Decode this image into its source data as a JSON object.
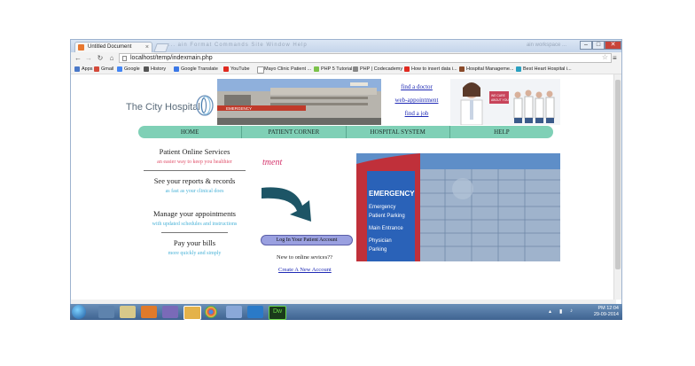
{
  "browser": {
    "tab_title": "Untitled Document",
    "tab_close": "×",
    "menu_words": "...  ain   Format   Commands   Site   Window   Help",
    "right_words": "ain  workspace ...",
    "url": "localhost/temp/indexmain.php",
    "window_controls": {
      "minimize": "–",
      "maximize": "□",
      "close": "✕"
    }
  },
  "bookmarks": [
    {
      "label": "Apps",
      "color": "#4a78c8"
    },
    {
      "label": "Gmail",
      "color": "#d44a3a"
    },
    {
      "label": "Google",
      "color": "#4285f4"
    },
    {
      "label": "History",
      "color": "#555555"
    },
    {
      "label": "Google Translate",
      "color": "#3b78e7"
    },
    {
      "label": "YouTube",
      "color": "#e02a20"
    },
    {
      "label": "Mayo Clinic Patient ...",
      "color": "#ffffff"
    },
    {
      "label": "PHP 5 Tutorial",
      "color": "#7cc24a"
    },
    {
      "label": "PHP | Codecademy",
      "color": "#888888"
    },
    {
      "label": "How to insert data i...",
      "color": "#e02a20"
    },
    {
      "label": "Hospital Manageme...",
      "color": "#8a4a2a"
    },
    {
      "label": "Best Heart Hospital i...",
      "color": "#2aa0c0"
    }
  ],
  "site": {
    "logo_text": "The City Hospital",
    "top_links": [
      "find a doctor",
      "web-appointment",
      "find a job"
    ],
    "doc_banner_text": "WE CARE ABOUT YOU",
    "nav": [
      "HOME",
      "PATIENT CORNER",
      "HOSPITAL SYSTEM",
      "HELP"
    ],
    "services": [
      {
        "title": "Patient Online Services",
        "subtitle": "an easier way to keep you healthier",
        "color": "#e0506a"
      },
      {
        "title": "See your reports & records",
        "subtitle": "as fast as your clinical does",
        "color": "#4bb3d8"
      },
      {
        "title": "Manage your appointments",
        "subtitle": "with updated schedules and instructions",
        "color": "#4bb3d8"
      },
      {
        "title": "Pay your bills",
        "subtitle": "more quickly and simply",
        "color": "#4bb3d8"
      }
    ],
    "tment_text": "tment",
    "login_button": "Log In Your Patient Account",
    "new_online": "New to online sevices??",
    "create_account": "Create A New Account",
    "hero_sign": {
      "l1": "EMERGENCY",
      "l2": "Emergency",
      "l3": "Patient Parking",
      "l4": "Main Entrance",
      "l5": "Physician",
      "l6": "Parking"
    }
  },
  "taskbar": {
    "time": "PM 12:04",
    "date": "29-09-2014",
    "dw_label": "Dw"
  }
}
